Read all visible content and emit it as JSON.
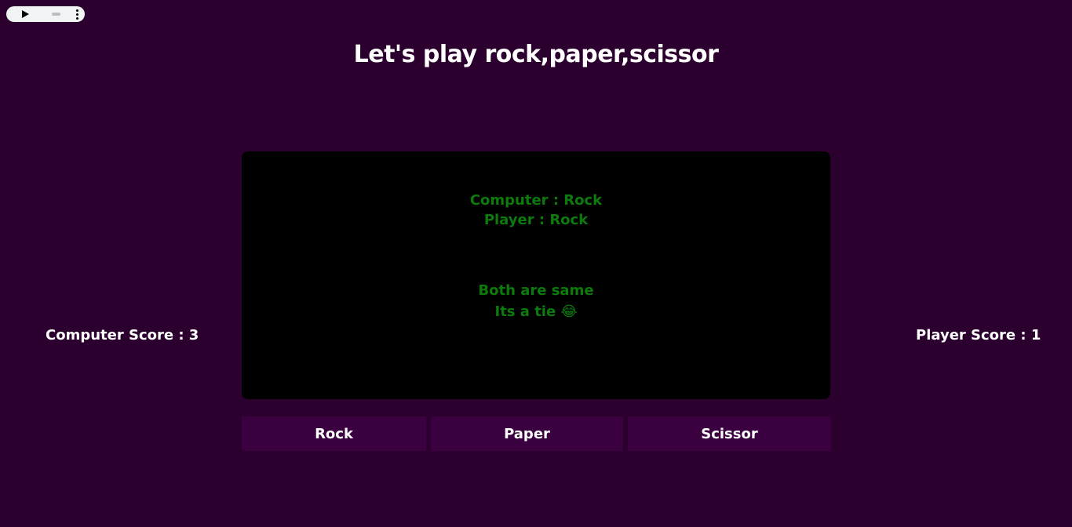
{
  "game": {
    "title": "Let's play rock,paper,scissor",
    "computer_choice": "Computer : Rock",
    "player_choice": "Player : Rock",
    "result_line1": "Both are same",
    "result_line2": "Its a tie 😂",
    "result_color": "#0c7a0c"
  },
  "scores": {
    "computer_label": "Computer Score : 3",
    "player_label": "Player Score : 1"
  },
  "buttons": {
    "rock_label": "Rock",
    "paper_label": "Paper",
    "scissor_label": "Scissor"
  },
  "audio_player": {
    "icons": [
      "play-icon",
      "volume-icon",
      "more-options-icon"
    ]
  },
  "colors": {
    "background": "#2c002e",
    "board": "#000000",
    "button": "#3b0040"
  }
}
